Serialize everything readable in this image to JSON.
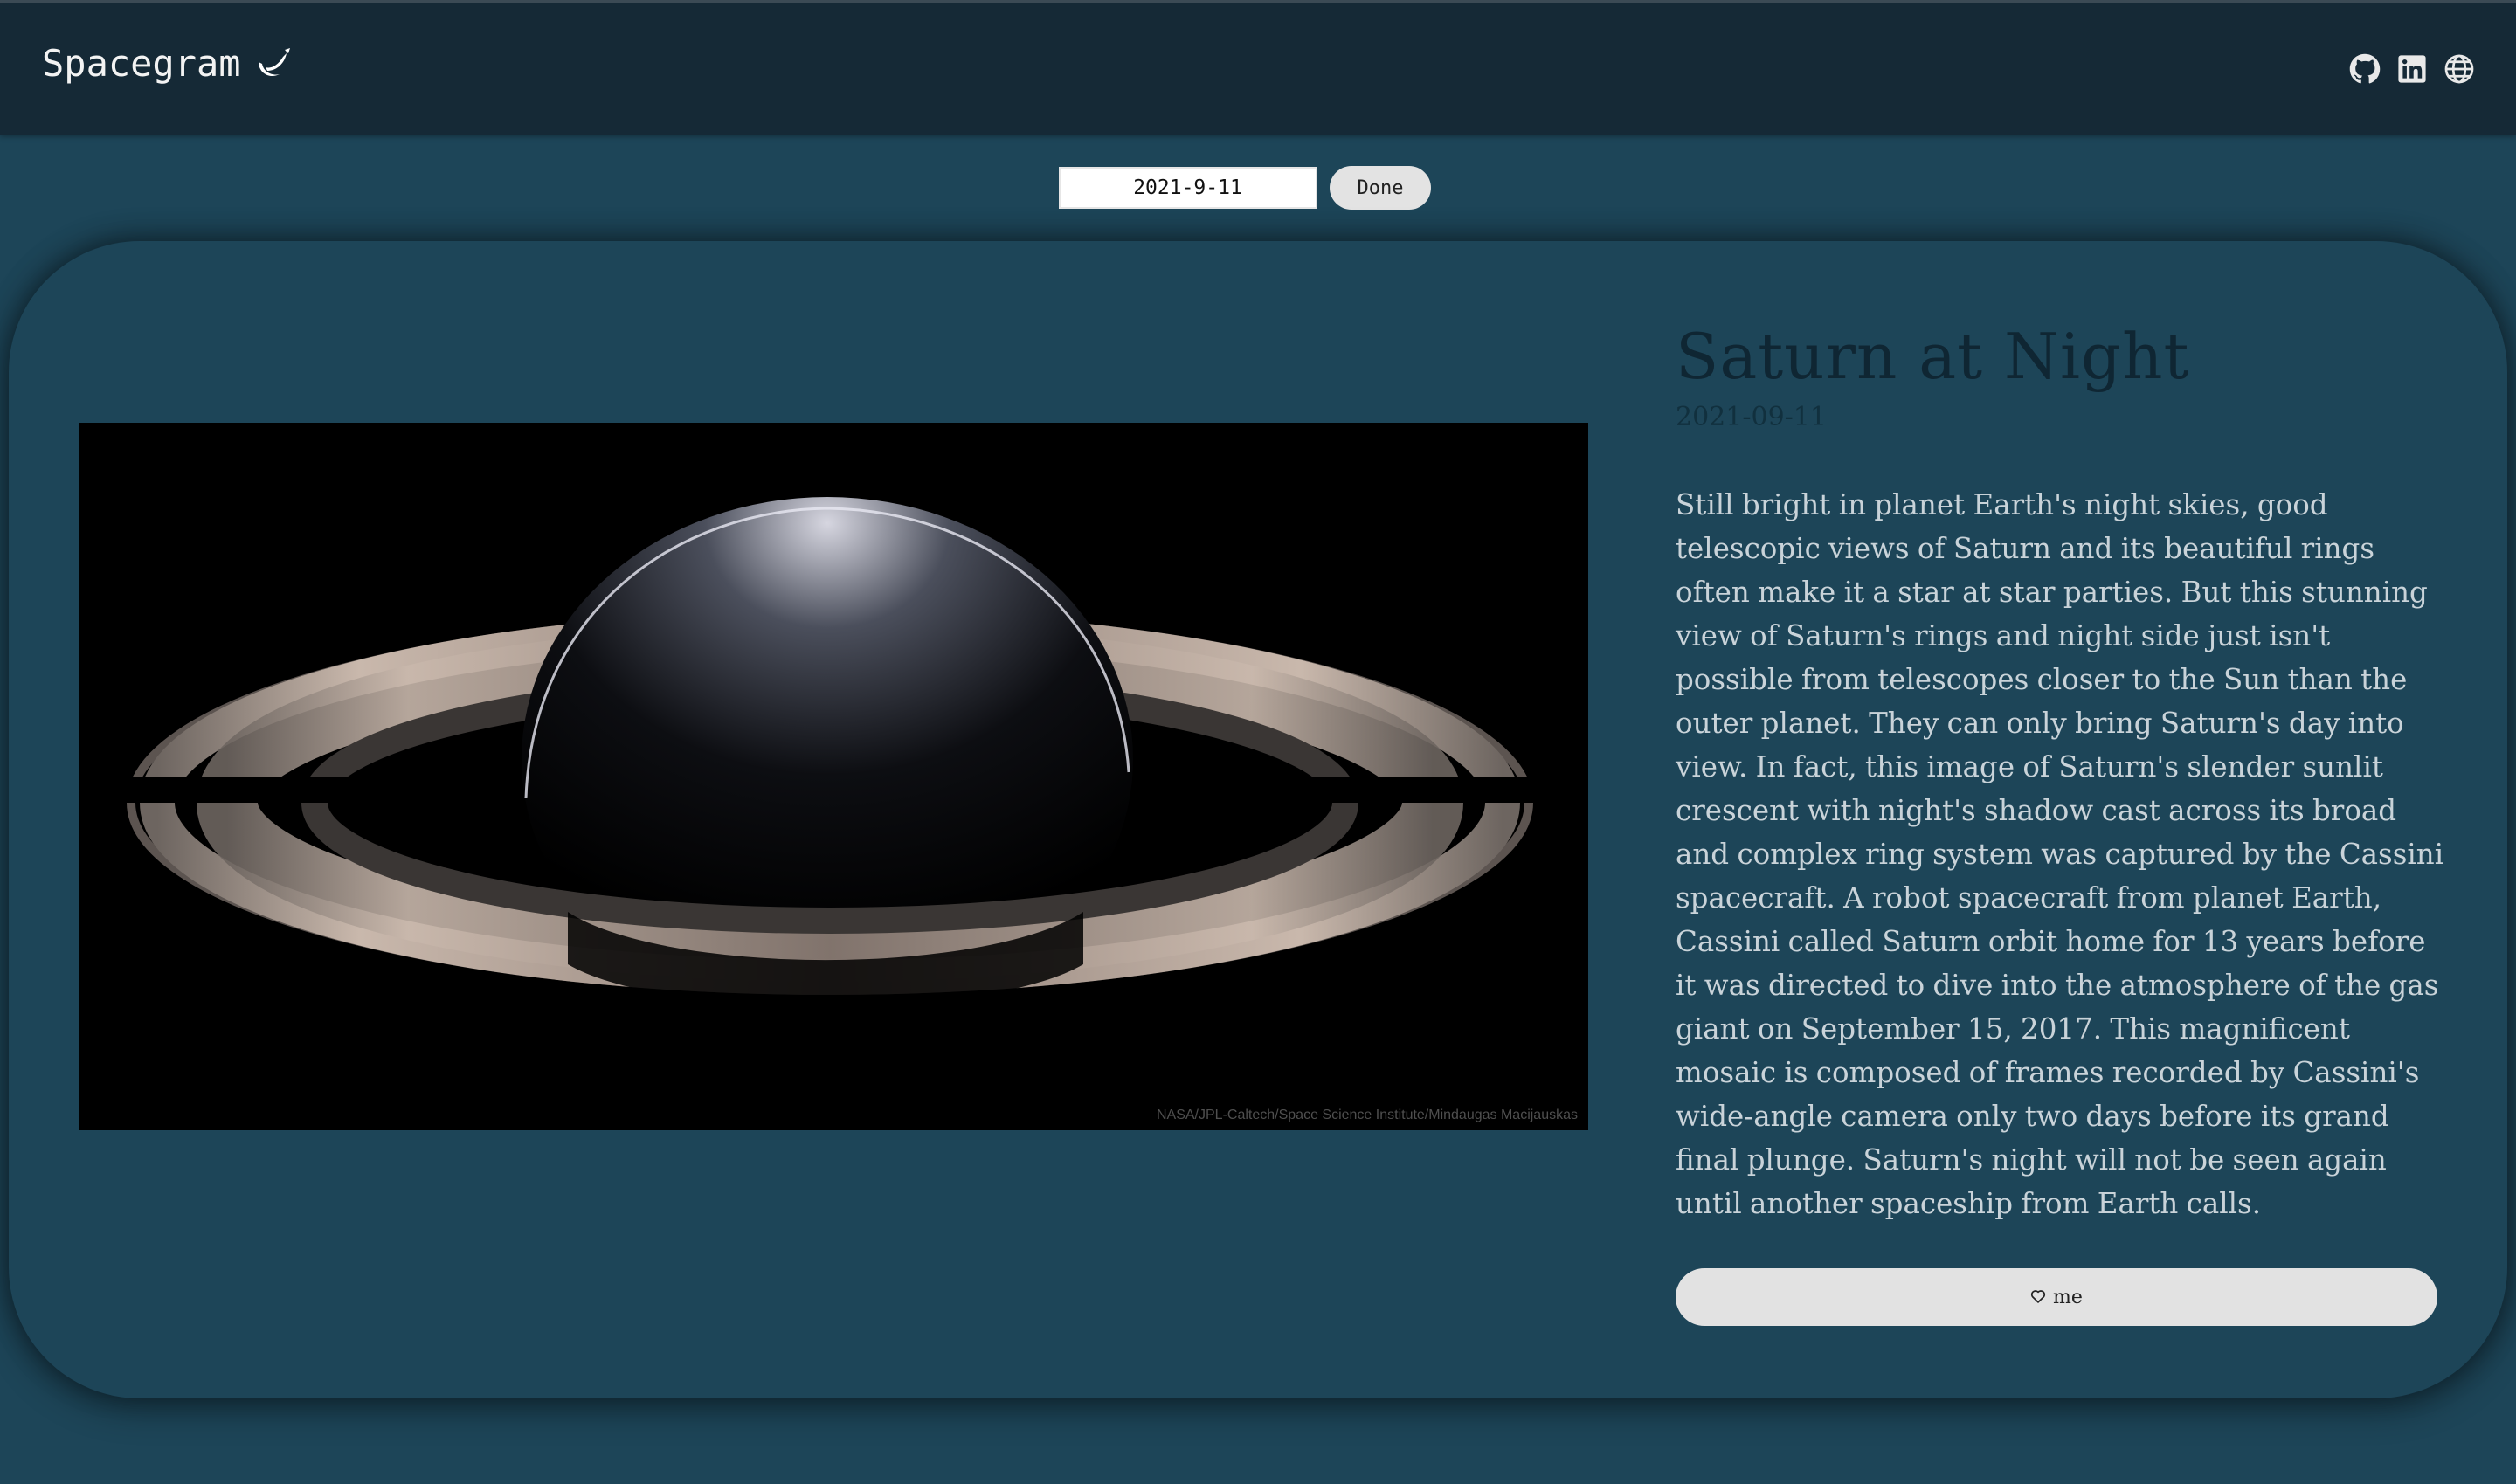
{
  "header": {
    "brand": "Spacegram",
    "logo_icon": "moon-rocket-icon",
    "social_icons": [
      "github-icon",
      "linkedin-icon",
      "globe-icon"
    ]
  },
  "date_picker": {
    "value": "2021-9-11",
    "done_label": "Done"
  },
  "post": {
    "title": "Saturn at Night",
    "date": "2021-09-11",
    "explanation": "Still bright in planet Earth's night skies, good telescopic views of Saturn and its beautiful rings often make it a star at star parties. But this stunning view of Saturn's rings and night side just isn't possible from telescopes closer to the Sun than the outer planet. They can only bring Saturn's day into view. In fact, this image of Saturn's slender sunlit crescent with night's shadow cast across its broad and complex ring system was captured by the Cassini spacecraft. A robot spacecraft from planet Earth, Cassini called Saturn orbit home for 13 years before it was directed to dive into the atmosphere of the gas giant on September 15, 2017. This magnificent mosaic is composed of frames recorded by Cassini's wide-angle camera only two days before its grand final plunge. Saturn's night will not be seen again until another spaceship from Earth calls.",
    "image_credit": "NASA/JPL-Caltech/Space Science Institute/Mindaugas Macijauskas",
    "like_label": "me",
    "like_icon": "heart-outline-icon"
  },
  "colors": {
    "page_bg": "#1d4558",
    "header_bg": "#152936",
    "title": "#0f2633",
    "body_text": "#c9d3d9",
    "button_bg": "#e2e2e2"
  }
}
